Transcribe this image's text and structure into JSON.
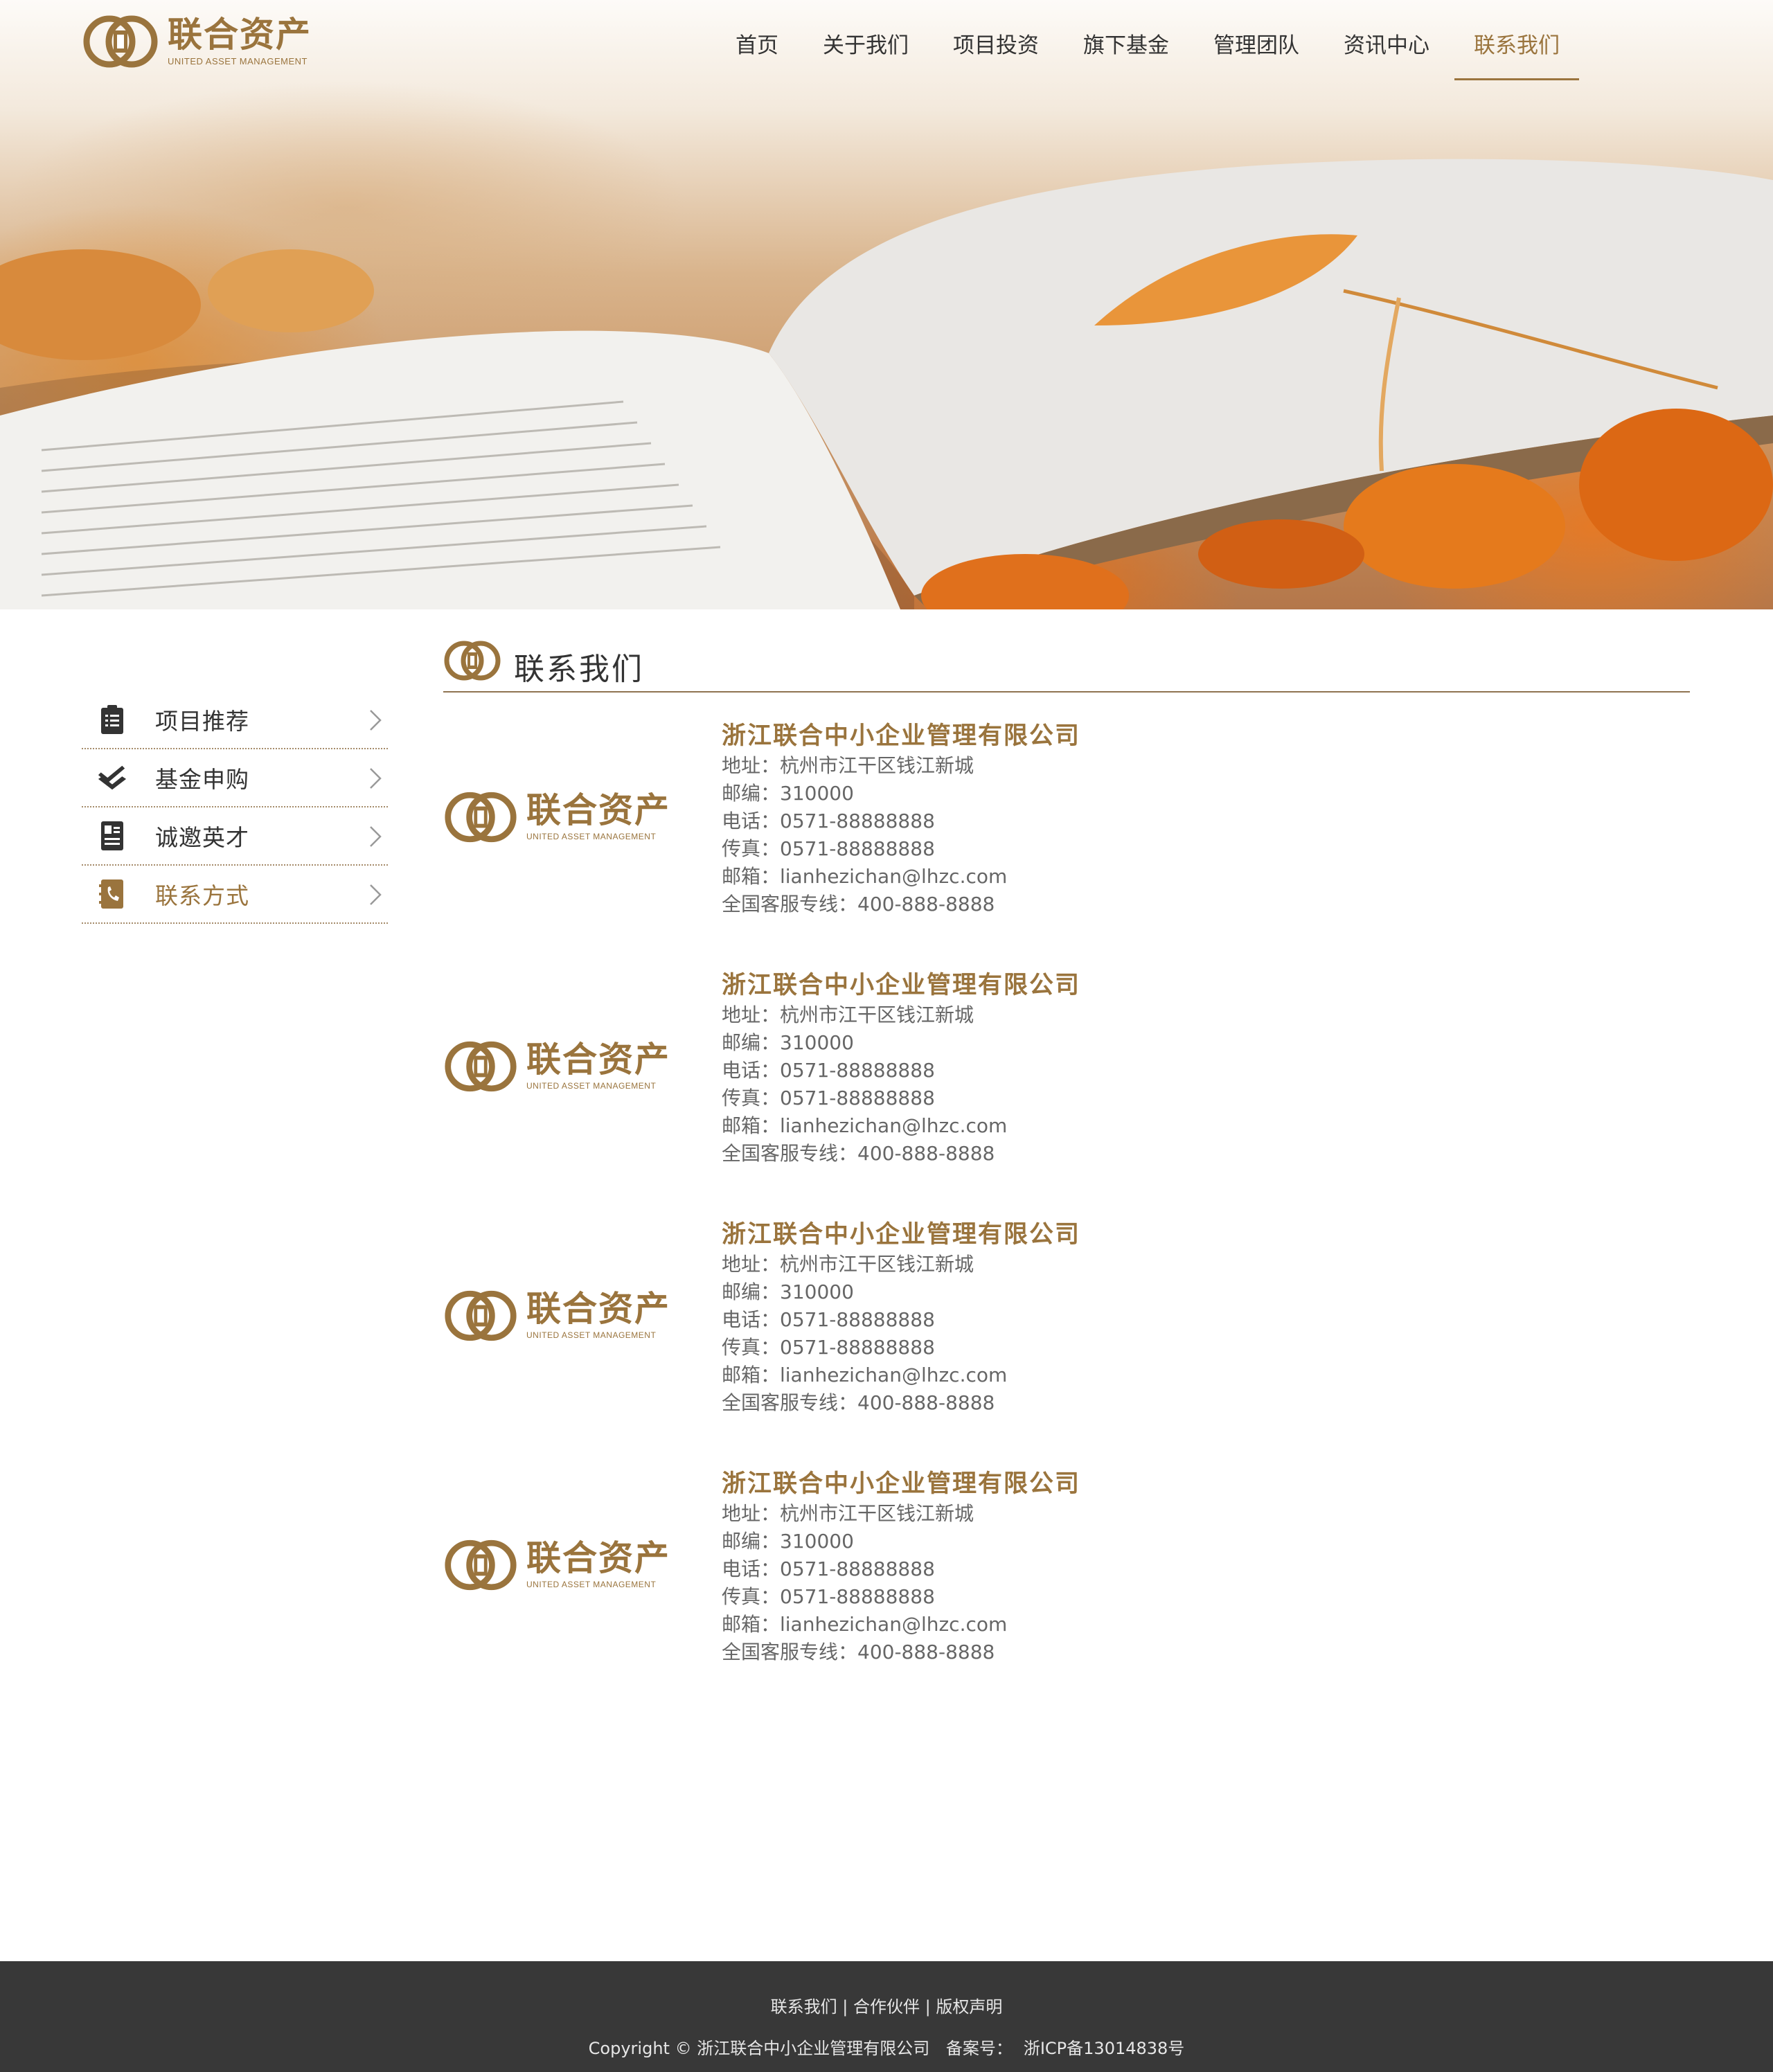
{
  "brand": {
    "name_cn": "联合资产",
    "name_en": "UNITED ASSET MANAGEMENT",
    "color": "#9a743d"
  },
  "nav": {
    "items": [
      "首页",
      "关于我们",
      "项目投资",
      "旗下基金",
      "管理团队",
      "资讯中心",
      "联系我们"
    ],
    "active": "联系我们"
  },
  "sidebar": {
    "items": [
      {
        "label": "项目推荐",
        "icon": "clipboard-list-icon"
      },
      {
        "label": "基金申购",
        "icon": "layers-check-icon"
      },
      {
        "label": "诚邀英才",
        "icon": "id-card-icon"
      },
      {
        "label": "联系方式",
        "icon": "phone-book-icon"
      }
    ],
    "active": "联系方式"
  },
  "main": {
    "title": "联系我们",
    "contacts": [
      {
        "company": "浙江联合中小企业管理有限公司",
        "address": "地址：杭州市江干区钱江新城",
        "postcode": "邮编：310000",
        "phone": "电话：0571-88888888",
        "fax": "传真：0571-88888888",
        "email": "邮箱：lianhezichan@lhzc.com",
        "hotline": "全国客服专线：400-888-8888"
      },
      {
        "company": "浙江联合中小企业管理有限公司",
        "address": "地址：杭州市江干区钱江新城",
        "postcode": "邮编：310000",
        "phone": "电话：0571-88888888",
        "fax": "传真：0571-88888888",
        "email": "邮箱：lianhezichan@lhzc.com",
        "hotline": "全国客服专线：400-888-8888"
      },
      {
        "company": "浙江联合中小企业管理有限公司",
        "address": "地址：杭州市江干区钱江新城",
        "postcode": "邮编：310000",
        "phone": "电话：0571-88888888",
        "fax": "传真：0571-88888888",
        "email": "邮箱：lianhezichan@lhzc.com",
        "hotline": "全国客服专线：400-888-8888"
      },
      {
        "company": "浙江联合中小企业管理有限公司",
        "address": "地址：杭州市江干区钱江新城",
        "postcode": "邮编：310000",
        "phone": "电话：0571-88888888",
        "fax": "传真：0571-88888888",
        "email": "邮箱：lianhezichan@lhzc.com",
        "hotline": "全国客服专线：400-888-8888"
      }
    ]
  },
  "footer": {
    "links": [
      "联系我们",
      "合作伙伴",
      "版权声明"
    ],
    "separator": "|",
    "copyright": "Copyright © 浙江联合中小企业管理有限公司",
    "record_label": "备案号：",
    "record_number": "浙ICP备13014838号"
  }
}
